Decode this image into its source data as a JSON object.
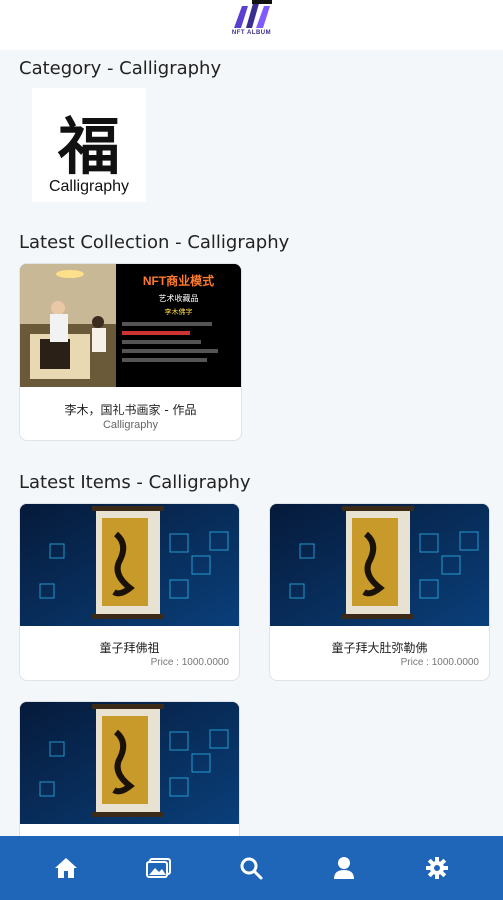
{
  "header": {
    "logo_text": "NFT ALBUM"
  },
  "category": {
    "title": "Category - Calligraphy",
    "tile_glyph": "福",
    "tile_label": "Calligraphy"
  },
  "collection": {
    "title": "Latest Collection - Calligraphy",
    "card": {
      "name": "李木，国礼书画家 - 作品",
      "category": "Calligraphy",
      "poster_title": "NFT商业模式",
      "poster_subtitle": "艺术收藏品",
      "poster_author": "李木佛字"
    }
  },
  "items": {
    "title": "Latest Items - Calligraphy",
    "list": [
      {
        "name": "童子拜佛祖",
        "price": "Price : 1000.0000"
      },
      {
        "name": "童子拜大肚弥勒佛",
        "price": "Price : 1000.0000"
      },
      {
        "name": "",
        "price": ""
      }
    ]
  },
  "nav": [
    {
      "icon": "home-icon"
    },
    {
      "icon": "gallery-icon"
    },
    {
      "icon": "search-icon"
    },
    {
      "icon": "profile-icon"
    },
    {
      "icon": "settings-icon"
    }
  ],
  "colors": {
    "nav_bg": "#1f65b8",
    "page_bg": "#f4f7f9",
    "price": "#777777"
  }
}
